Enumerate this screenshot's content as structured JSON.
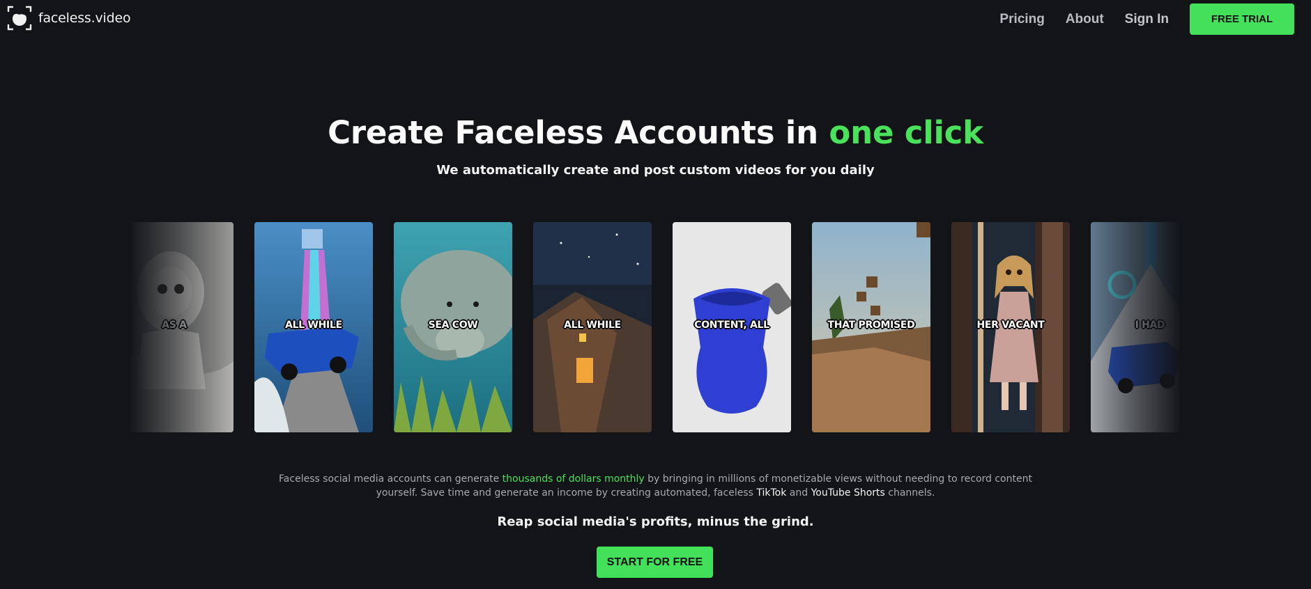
{
  "brand": {
    "name": "faceless.video"
  },
  "nav": {
    "pricing": "Pricing",
    "about": "About",
    "sign_in": "Sign In",
    "free_trial": "FREE TRIAL"
  },
  "hero": {
    "title_main": "Create Faceless Accounts in ",
    "title_accent": "one click",
    "subtitle": "We automatically create and post custom videos for you daily"
  },
  "videos": [
    {
      "caption": "AS A",
      "icon": "doll-thumbnail"
    },
    {
      "caption": "ALL WHILE",
      "icon": "car-track-thumbnail"
    },
    {
      "caption": "SEA COW",
      "icon": "manatee-thumbnail"
    },
    {
      "caption": "ALL WHILE",
      "icon": "minecraft-night-thumbnail"
    },
    {
      "caption": "CONTENT, ALL",
      "icon": "kinetic-sand-thumbnail"
    },
    {
      "caption": "THAT PROMISED",
      "icon": "minecraft-parkour-thumbnail"
    },
    {
      "caption": "HER VACANT",
      "icon": "doll-door-thumbnail"
    },
    {
      "caption": "I HAD",
      "icon": "car-ramp-thumbnail"
    }
  ],
  "description": {
    "part1": "Faceless social media accounts can generate ",
    "highlight": "thousands of dollars monthly",
    "part2": " by bringing in millions of monetizable views without needing to record content yourself. Save time and generate an income by creating automated, faceless ",
    "tiktok": "TikTok",
    "and": " and ",
    "youtube": "YouTube Shorts",
    "part3": " channels."
  },
  "tagline": "Reap social media's profits, minus the grind.",
  "cta": {
    "start": "START FOR FREE"
  },
  "colors": {
    "background": "#121418",
    "accent": "#43e05a",
    "text": "#ffffff",
    "muted": "#a7aab0"
  }
}
